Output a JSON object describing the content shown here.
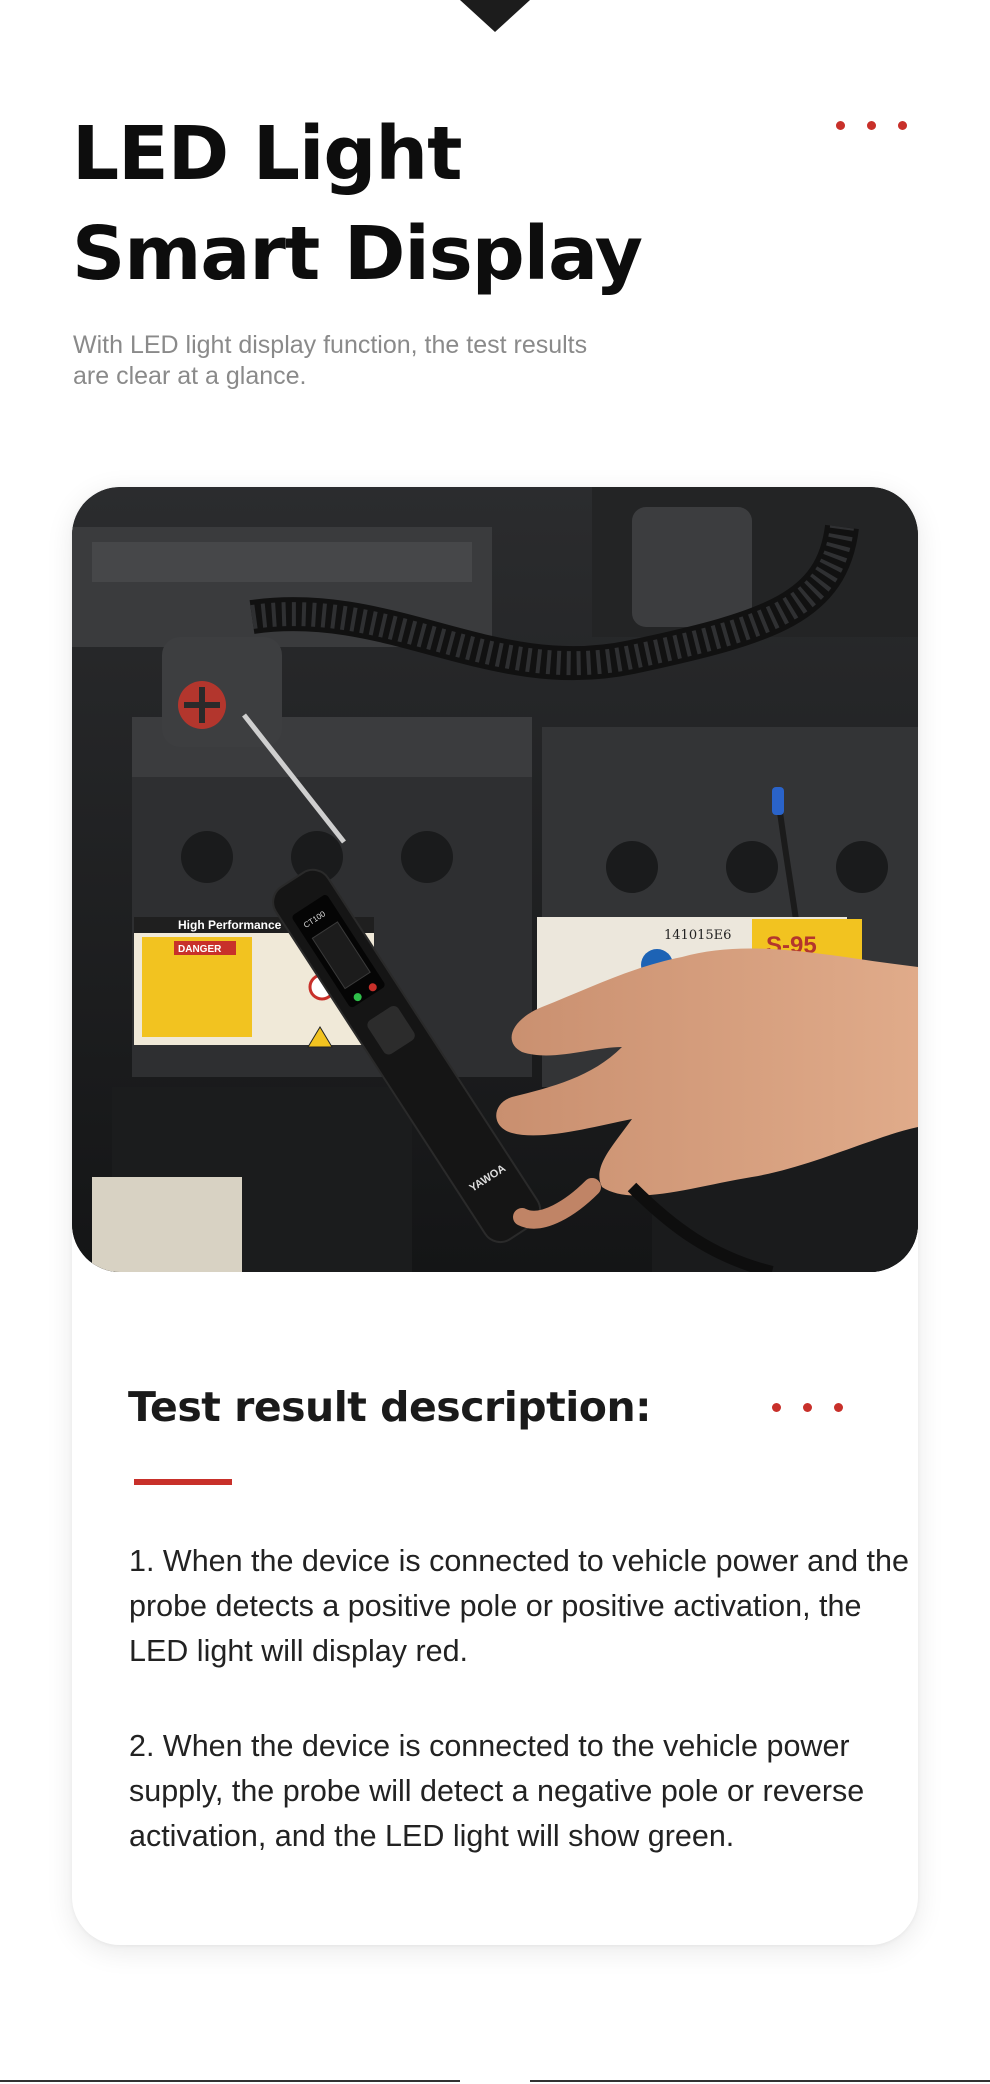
{
  "hero": {
    "title_line1": "LED Light",
    "title_line2": "Smart Display",
    "subtitle_line1": "With LED light display function, the test results",
    "subtitle_line2": "are clear at a glance."
  },
  "photo": {
    "battery_label": "High Performance",
    "danger_label": "DANGER",
    "battery_code": "141015E6",
    "battery_model": "S-95",
    "device_model": "CT100",
    "brand": "YAWOA"
  },
  "description": {
    "title": "Test result description:",
    "item1": "1. When the device is connected to vehicle power and the probe detects a positive pole or positive activation, the LED light will display red.",
    "item2": "2. When the device is connected to the vehicle power supply, the probe will detect a negative pole or reverse activation, and the LED light will show green."
  },
  "colors": {
    "accent": "#c8302a",
    "title": "#0d0d0d",
    "subtitle": "#8a8a8a"
  }
}
